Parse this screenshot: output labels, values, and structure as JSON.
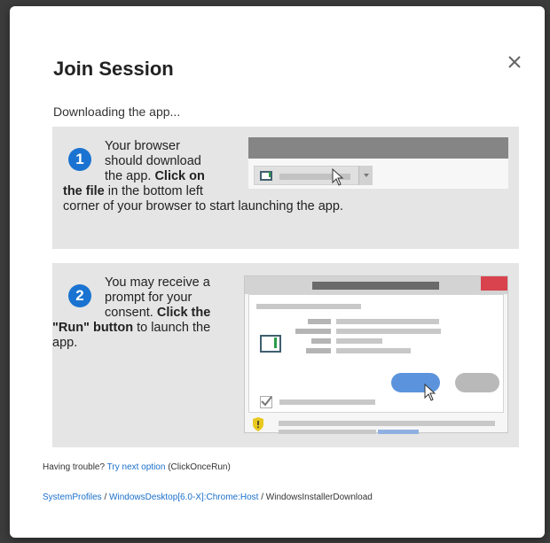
{
  "dialog": {
    "title": "Join Session",
    "status": "Downloading the app..."
  },
  "step1": {
    "number": "1",
    "text_part1_line1": "Your browser",
    "text_part1_line2": "should download",
    "text_part1_line3": "the app.",
    "text_bold": "Click on the file",
    "text_bold_part1": "Click on",
    "text_bold_part2": "the file",
    "text_part2_line1": "in the bottom left",
    "text_part2_line2": "corner of your browser to start launching the app."
  },
  "step2": {
    "number": "2",
    "text_line1": "You may receive a",
    "text_line2": "prompt for your",
    "text_line3": "consent.",
    "text_bold1": "Click the",
    "text_bold2": "\"Run\" button",
    "text_line4": "to launch the",
    "text_line5": "app."
  },
  "footer": {
    "trouble_text": "Having trouble?",
    "trouble_link": "Try next option",
    "trouble_suffix": "(ClickOnceRun)",
    "crumb1": "SystemProfiles",
    "crumb2": "WindowsDesktop[6.0-X]:Chrome:Host",
    "crumb3": "WindowsInstallerDownload",
    "separator": " / "
  },
  "icons": {
    "close": "close-icon",
    "cursor": "cursor-icon",
    "shield": "shield-warning-icon"
  },
  "colors": {
    "accent": "#1a73d1",
    "run_button": "#5b94dd",
    "close_window": "#d8434d",
    "warning": "#e8c81e"
  }
}
